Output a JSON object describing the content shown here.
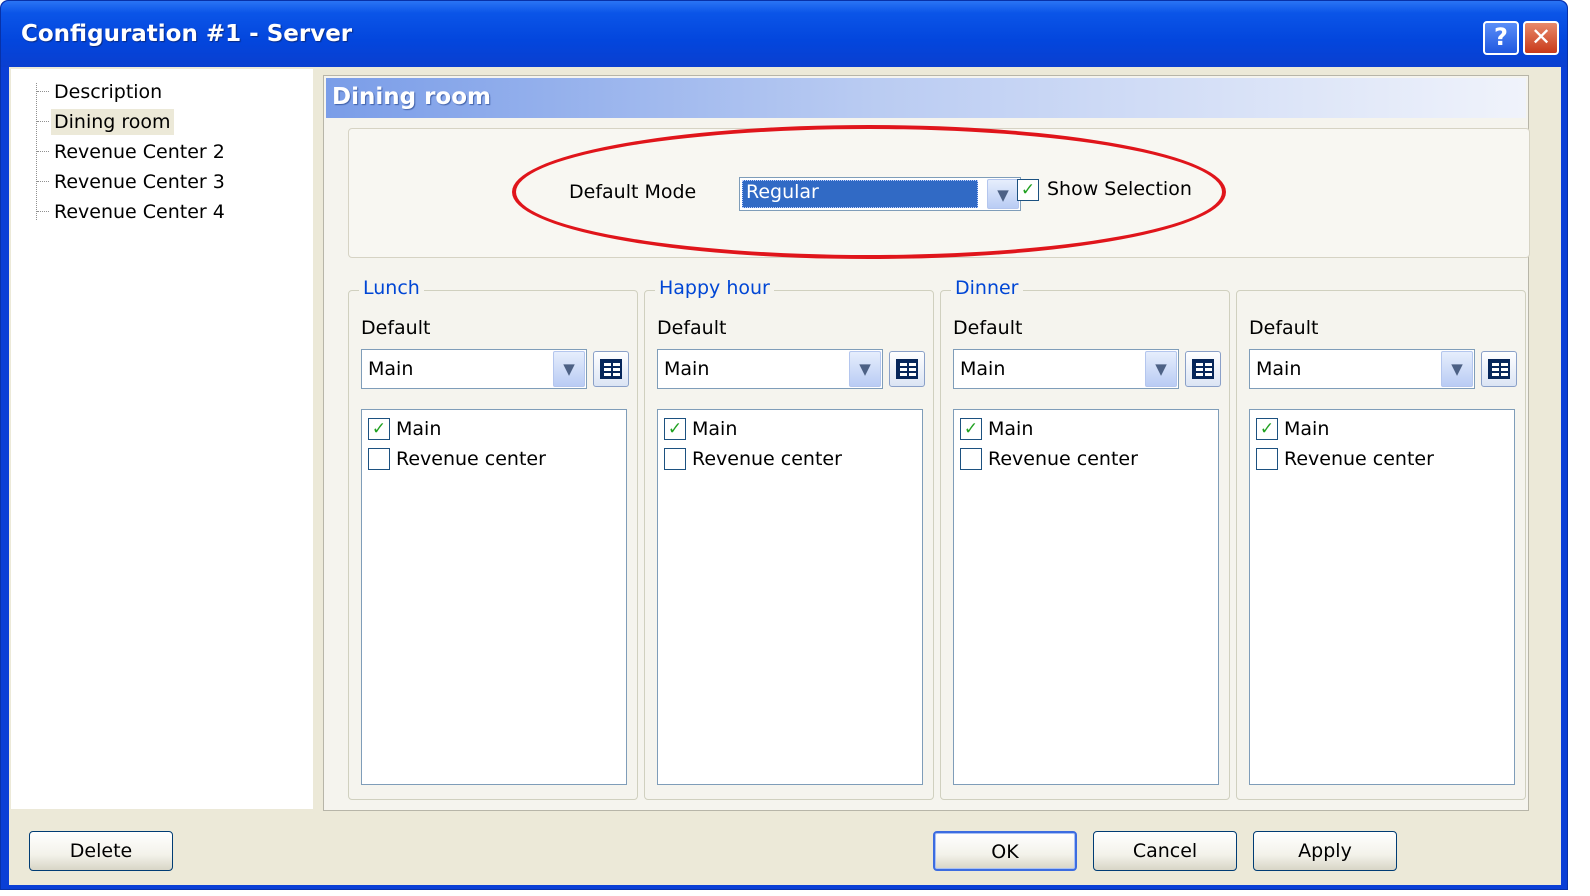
{
  "window": {
    "title": "Configuration #1 - Server",
    "help_label": "?",
    "close_label": "✕"
  },
  "tree": {
    "items": [
      {
        "label": "Description"
      },
      {
        "label": "Dining room",
        "selected": true
      },
      {
        "label": "Revenue Center 2"
      },
      {
        "label": "Revenue Center 3"
      },
      {
        "label": "Revenue Center 4"
      }
    ]
  },
  "panel": {
    "title": "Dining room",
    "default_mode_label": "Default Mode",
    "default_mode_value": "Regular",
    "show_selection_label": "Show Selection",
    "show_selection_checked": true
  },
  "groups": [
    {
      "title": "Lunch",
      "default_label": "Default",
      "combo_value": "Main",
      "items": [
        {
          "label": "Main",
          "checked": true
        },
        {
          "label": "Revenue center",
          "checked": false
        }
      ]
    },
    {
      "title": "Happy hour",
      "default_label": "Default",
      "combo_value": "Main",
      "items": [
        {
          "label": "Main",
          "checked": true
        },
        {
          "label": "Revenue center",
          "checked": false
        }
      ]
    },
    {
      "title": "Dinner",
      "default_label": "Default",
      "combo_value": "Main",
      "items": [
        {
          "label": "Main",
          "checked": true
        },
        {
          "label": "Revenue center",
          "checked": false
        }
      ]
    },
    {
      "title": "",
      "default_label": "Default",
      "combo_value": "Main",
      "items": [
        {
          "label": "Main",
          "checked": true
        },
        {
          "label": "Revenue center",
          "checked": false
        }
      ]
    }
  ],
  "buttons": {
    "delete": "Delete",
    "ok": "OK",
    "cancel": "Cancel",
    "apply": "Apply"
  },
  "icons": {
    "dropdown": "chevron-down-icon",
    "check": "checkmark-icon",
    "grid": "grid-view-icon"
  },
  "colors": {
    "titlebar": "#0346dd",
    "selection": "#316ac5",
    "group_title": "#0046d5",
    "annotation": "#e0151b"
  }
}
